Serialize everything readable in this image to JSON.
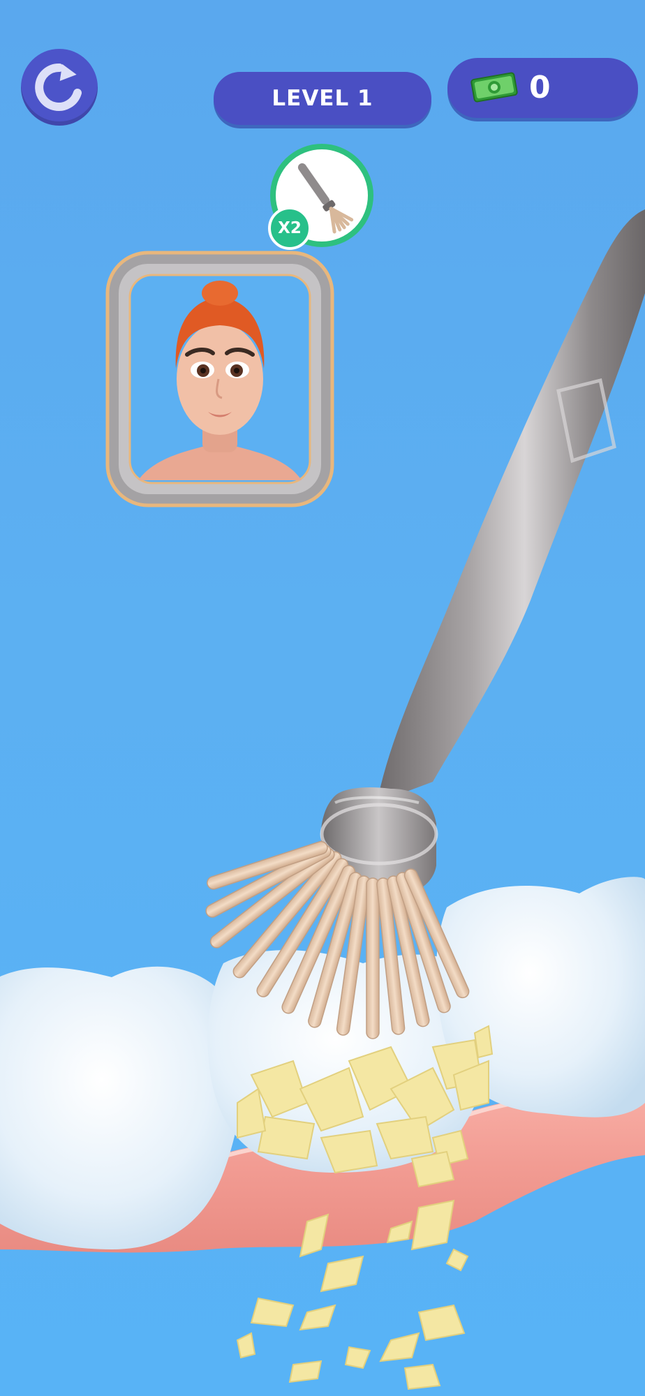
{
  "hud": {
    "level_label": "LEVEL 1",
    "cash_count": "0",
    "restart_icon": "restart-icon",
    "cash_icon": "cash-bill-icon"
  },
  "tool": {
    "icon": "brush-tool-icon",
    "multiplier": "X2"
  },
  "target": {
    "icon": "patient-portrait"
  },
  "colors": {
    "hud_blue": "#4a4fc3",
    "background": "#5cb0f2",
    "tooth": "#e8f3fb",
    "gum": "#f4a39b",
    "plaque": "#f4e7a3",
    "badge_green": "#27c08a"
  }
}
